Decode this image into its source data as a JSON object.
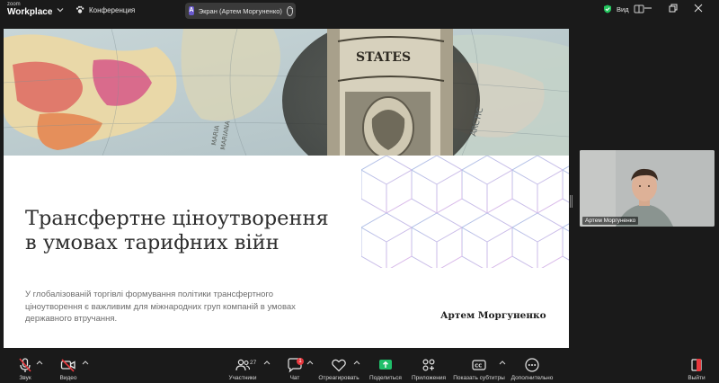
{
  "app": {
    "logo_small": "zoom",
    "logo_big": "Workplace"
  },
  "header": {
    "meeting_label": "Конференция",
    "share_label": "Экран (Артем Моргуненко)",
    "view_label": "Вид"
  },
  "slide": {
    "title": "Трансфертне ціноутворення в умовах тарифних війн",
    "subtitle": "У глобалізованій торгівлі формування політики трансфертного ціноутворення є важливим для міжнародних груп компаній в умовах державного втручання.",
    "author": "Артем Моргуненко",
    "banknote_text": "STATES",
    "map_text_1": "ARCTIC",
    "map_text_2": "MARIA",
    "map_text_3": "MARIANA"
  },
  "participant": {
    "name": "Артем Моргуненко"
  },
  "toolbar": {
    "mute_label": "Звук",
    "video_label": "Видео",
    "participants_label": "Участники",
    "participants_count": "27",
    "chat_label": "Чат",
    "chat_badge": "1",
    "react_label": "Отреагировать",
    "share_label": "Поделиться",
    "apps_label": "Приложения",
    "captions_label": "Показать субтитры",
    "more_label": "Дополнительно",
    "leave_label": "Выйти"
  },
  "colors": {
    "background": "#1a1a1a",
    "share_green": "#1fbf6a",
    "alert_red": "#e8383d",
    "shield_green": "#23c55e",
    "share_badge": "#6a5acd"
  }
}
